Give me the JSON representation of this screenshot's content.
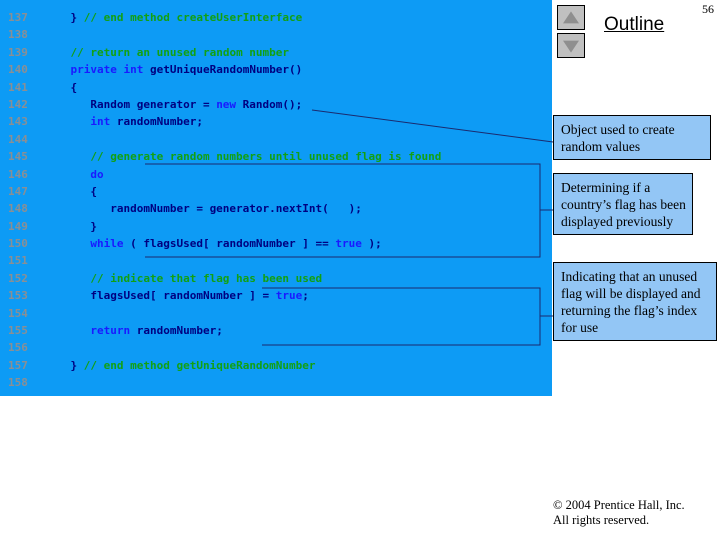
{
  "slide": {
    "page_number": "56",
    "title": "Outline",
    "nav_up_icon": "triangle-up-icon",
    "nav_down_icon": "triangle-down-icon",
    "panel_color": "#0d9bf5",
    "callout_color": "#93c6f5"
  },
  "code": {
    "language": "Java",
    "first_line_number": 137,
    "lines": [
      {
        "n": "137",
        "tokens": [
          {
            "t": "    } ",
            "c": "pl"
          },
          {
            "t": "// end method createUserInterface",
            "c": "cmt"
          }
        ]
      },
      {
        "n": "138",
        "tokens": []
      },
      {
        "n": "139",
        "tokens": [
          {
            "t": "    ",
            "c": "pl"
          },
          {
            "t": "// return an unused random number",
            "c": "cmt"
          }
        ]
      },
      {
        "n": "140",
        "tokens": [
          {
            "t": "    ",
            "c": "pl"
          },
          {
            "t": "private int",
            "c": "kw"
          },
          {
            "t": " getUniqueRandomNumber()",
            "c": "pl"
          }
        ]
      },
      {
        "n": "141",
        "tokens": [
          {
            "t": "    {",
            "c": "pl"
          }
        ]
      },
      {
        "n": "142",
        "tokens": [
          {
            "t": "       Random generator = ",
            "c": "pl"
          },
          {
            "t": "new",
            "c": "kw"
          },
          {
            "t": " Random();",
            "c": "pl"
          }
        ]
      },
      {
        "n": "143",
        "tokens": [
          {
            "t": "       ",
            "c": "pl"
          },
          {
            "t": "int",
            "c": "kw"
          },
          {
            "t": " randomNumber;",
            "c": "pl"
          }
        ]
      },
      {
        "n": "144",
        "tokens": []
      },
      {
        "n": "145",
        "tokens": [
          {
            "t": "       ",
            "c": "pl"
          },
          {
            "t": "// generate random numbers until unused flag is found",
            "c": "cmt"
          }
        ]
      },
      {
        "n": "146",
        "tokens": [
          {
            "t": "       ",
            "c": "pl"
          },
          {
            "t": "do",
            "c": "kw"
          }
        ]
      },
      {
        "n": "147",
        "tokens": [
          {
            "t": "       {",
            "c": "pl"
          }
        ]
      },
      {
        "n": "148",
        "tokens": [
          {
            "t": "          randomNumber = generator.nextInt(   );",
            "c": "pl"
          }
        ]
      },
      {
        "n": "149",
        "tokens": [
          {
            "t": "       }",
            "c": "pl"
          }
        ]
      },
      {
        "n": "150",
        "tokens": [
          {
            "t": "       ",
            "c": "pl"
          },
          {
            "t": "while",
            "c": "kw"
          },
          {
            "t": " ( flagsUsed[ randomNumber ] == ",
            "c": "pl"
          },
          {
            "t": "true",
            "c": "kw"
          },
          {
            "t": " );",
            "c": "pl"
          }
        ]
      },
      {
        "n": "151",
        "tokens": []
      },
      {
        "n": "152",
        "tokens": [
          {
            "t": "       ",
            "c": "pl"
          },
          {
            "t": "// indicate that flag has been used",
            "c": "cmt"
          }
        ]
      },
      {
        "n": "153",
        "tokens": [
          {
            "t": "       flagsUsed[ randomNumber ] = ",
            "c": "pl"
          },
          {
            "t": "true",
            "c": "kw"
          },
          {
            "t": ";",
            "c": "pl"
          }
        ]
      },
      {
        "n": "154",
        "tokens": []
      },
      {
        "n": "155",
        "tokens": [
          {
            "t": "       ",
            "c": "pl"
          },
          {
            "t": "return",
            "c": "kw"
          },
          {
            "t": " randomNumber;",
            "c": "pl"
          }
        ]
      },
      {
        "n": "156",
        "tokens": []
      },
      {
        "n": "157",
        "tokens": [
          {
            "t": "    } ",
            "c": "pl"
          },
          {
            "t": "// end method getUniqueRandomNumber",
            "c": "cmt"
          }
        ]
      },
      {
        "n": "158",
        "tokens": []
      }
    ]
  },
  "callouts": [
    {
      "id": "callout-1",
      "text": "Object used to create random values"
    },
    {
      "id": "callout-2",
      "text": "Determining if a country’s flag has been displayed previously"
    },
    {
      "id": "callout-3",
      "text": "Indicating that an unused flag will be displayed and returning the flag’s index for use"
    }
  ],
  "footer": {
    "copyright": "© 2004 Prentice Hall, Inc.",
    "rights": "All rights reserved."
  }
}
